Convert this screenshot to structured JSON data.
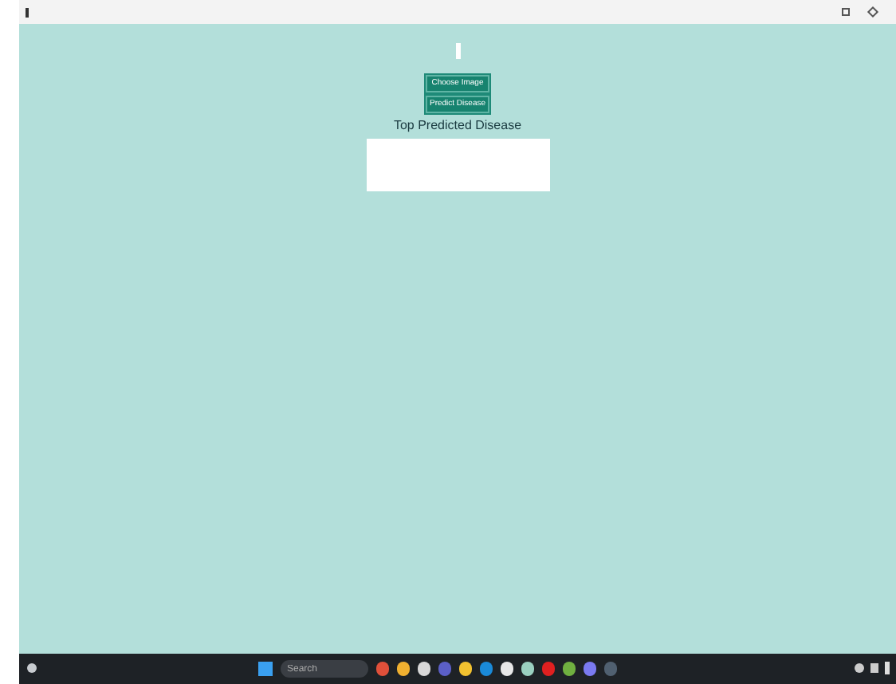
{
  "window": {
    "buttons": [
      {
        "label": "Choose Image"
      },
      {
        "label": "Predict Disease"
      }
    ],
    "result_label": "Top Predicted Disease"
  },
  "taskbar": {
    "search": {
      "placeholder": "Search"
    },
    "apps": [
      {
        "color": "#e0503a"
      },
      {
        "color": "#f0b030"
      },
      {
        "color": "#d8d8d8"
      },
      {
        "color": "#5b5fc7"
      },
      {
        "color": "#f2c230"
      },
      {
        "color": "#1a8ad8"
      },
      {
        "color": "#e8e8e8"
      },
      {
        "color": "#9ad0c0"
      },
      {
        "color": "#e02020"
      },
      {
        "color": "#70b040"
      },
      {
        "color": "#7a7af0"
      },
      {
        "color": "#506070"
      }
    ]
  }
}
